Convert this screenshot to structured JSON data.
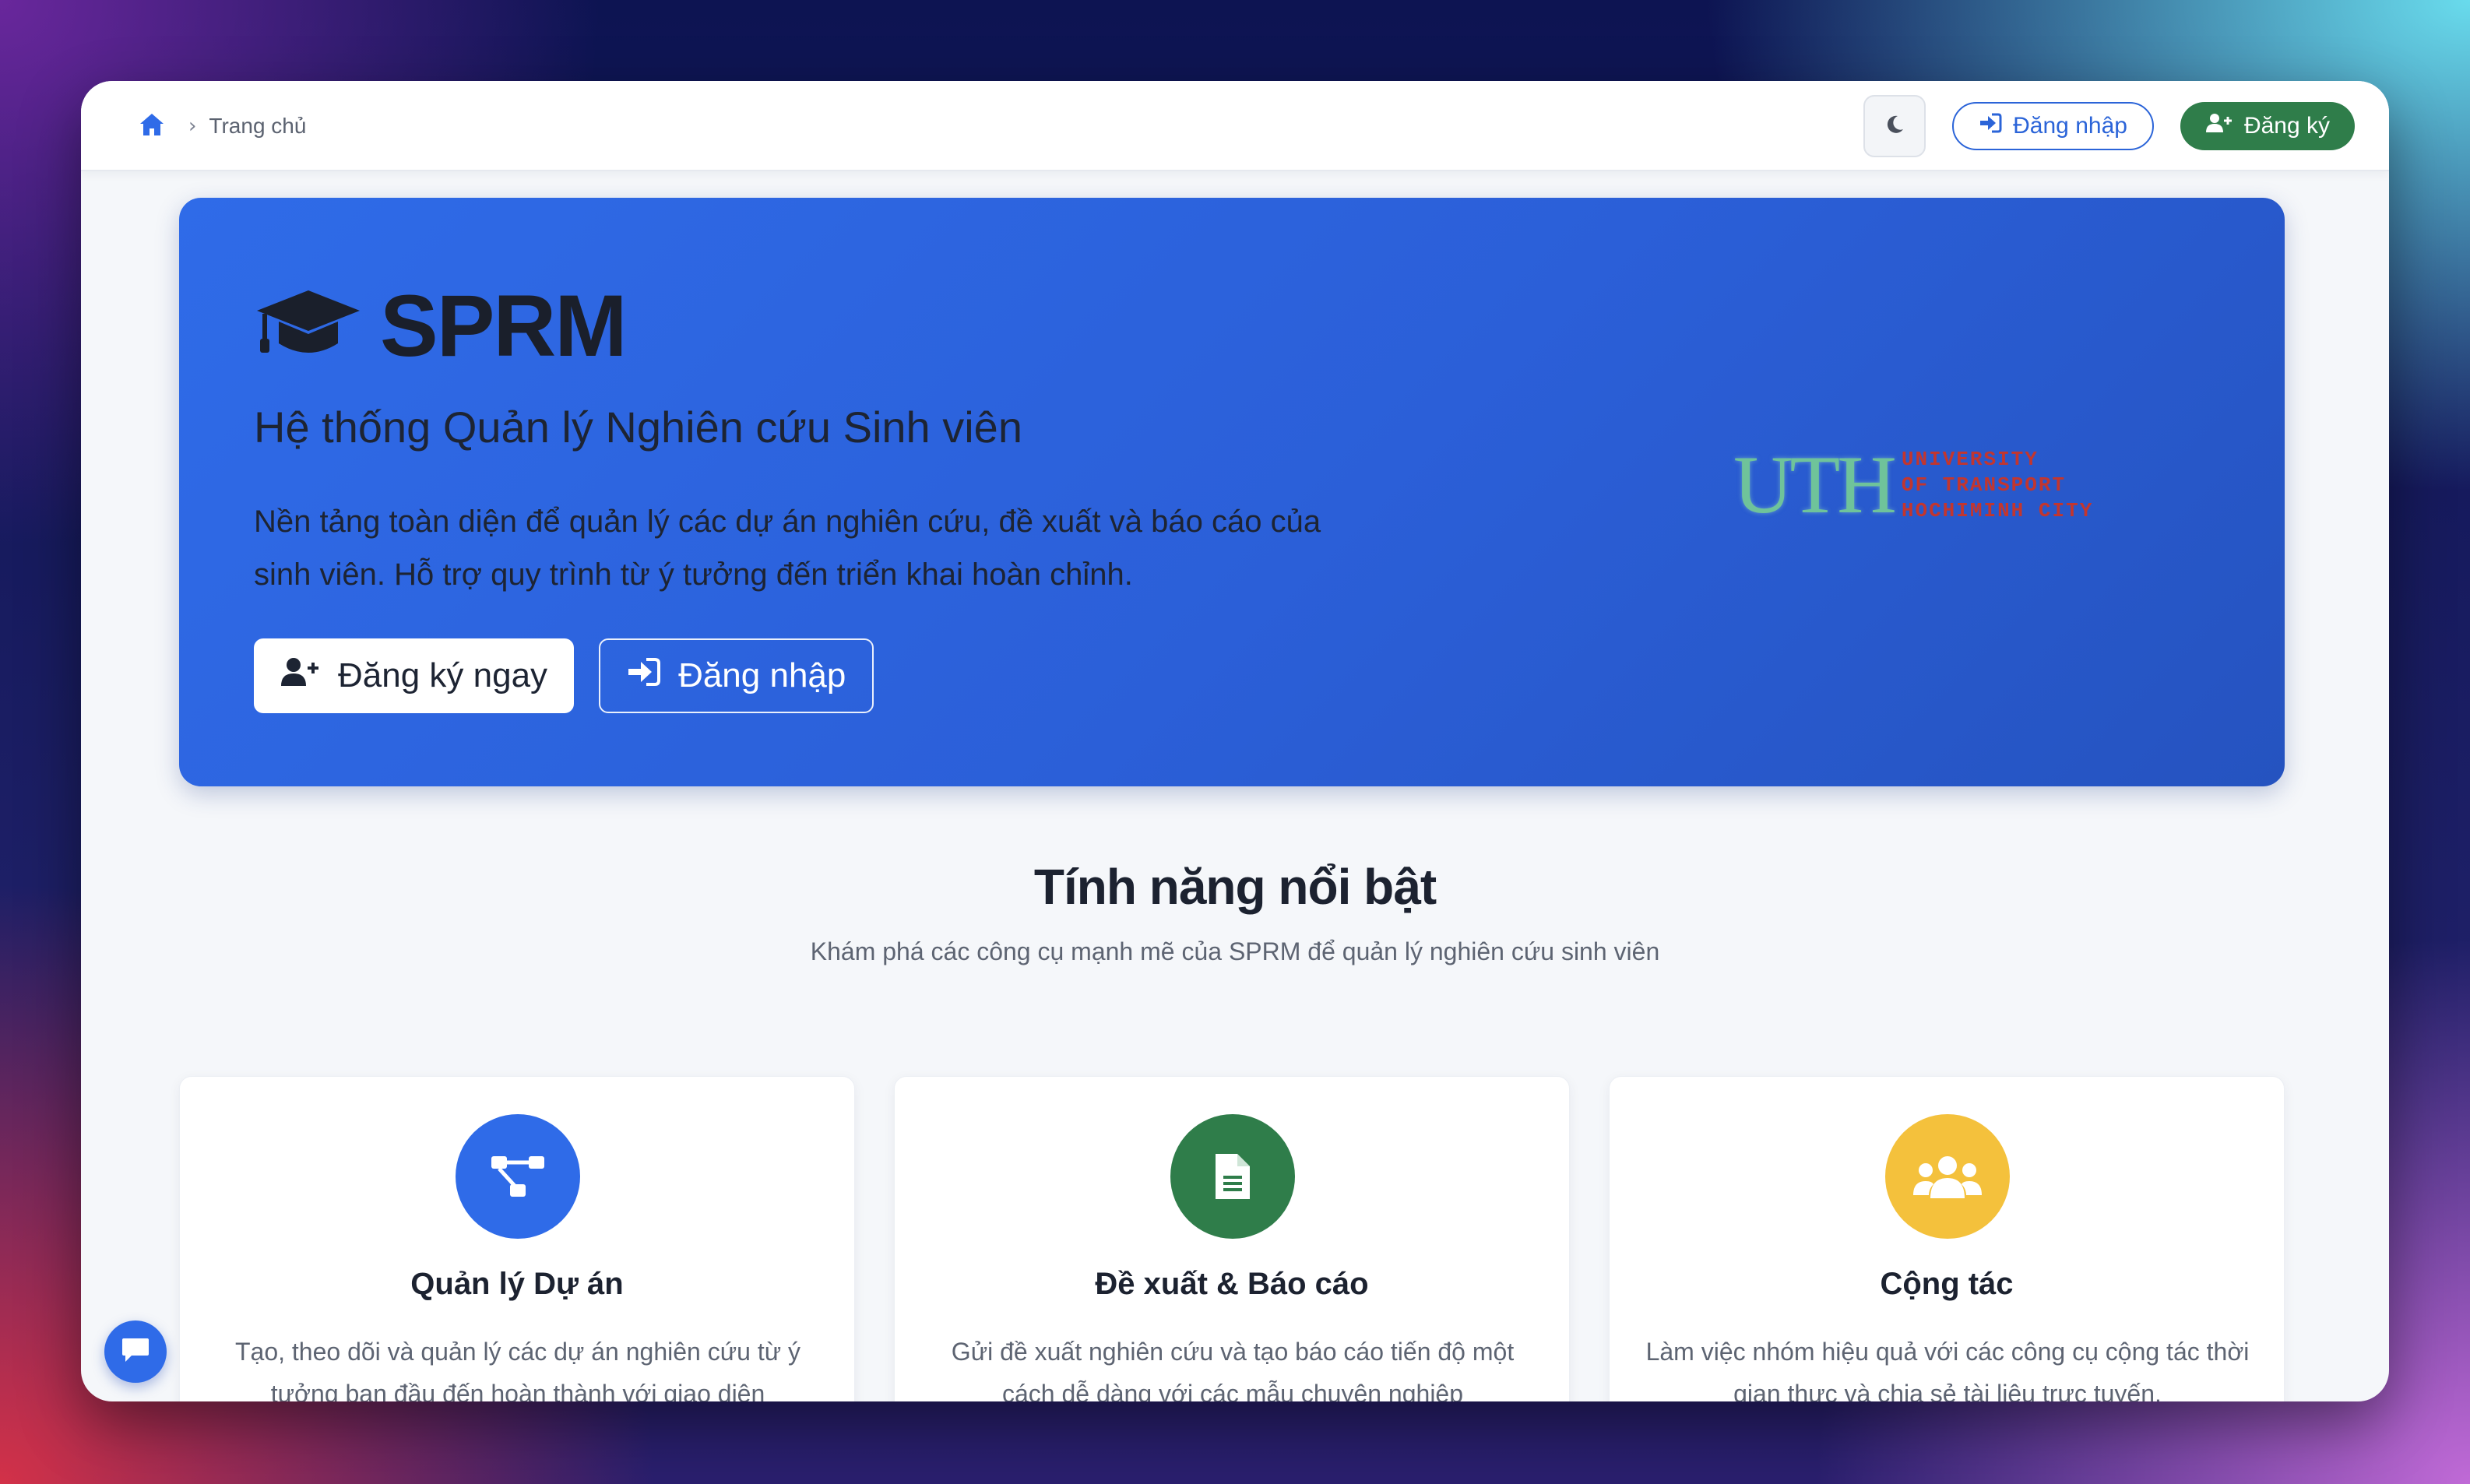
{
  "breadcrumb": {
    "home_icon": "home-icon",
    "current": "Trang chủ"
  },
  "header": {
    "theme_icon": "moon-icon",
    "login_label": "Đăng nhập",
    "register_label": "Đăng ký"
  },
  "hero": {
    "brand": "SPRM",
    "brand_icon": "graduation-cap-icon",
    "subtitle": "Hệ thống Quản lý Nghiên cứu Sinh viên",
    "description": "Nền tảng toàn diện để quản lý các dự án nghiên cứu, đề xuất và báo cáo của sinh viên. Hỗ trợ quy trình từ ý tưởng đến triển khai hoàn chỉnh.",
    "register_now_label": "Đăng ký ngay",
    "login_label": "Đăng nhập",
    "logo": {
      "mark": "UTH",
      "line1": "UNIVERSITY",
      "line2": "OF TRANSPORT",
      "line3": "HOCHIMINH CITY"
    }
  },
  "features": {
    "title": "Tính năng nổi bật",
    "subtitle": "Khám phá các công cụ mạnh mẽ của SPRM để quản lý nghiên cứu sinh viên",
    "cards": [
      {
        "title": "Quản lý Dự án",
        "text": "Tạo, theo dõi và quản lý các dự án nghiên cứu từ ý tưởng ban đầu đến hoàn thành với giao diện",
        "icon": "project-diagram-icon",
        "color": "#2f6be8"
      },
      {
        "title": "Đề xuất & Báo cáo",
        "text": "Gửi đề xuất nghiên cứu và tạo báo cáo tiến độ một cách dễ dàng với các mẫu chuyên nghiệp",
        "icon": "document-icon",
        "color": "#2f7d4a"
      },
      {
        "title": "Cộng tác",
        "text": "Làm việc nhóm hiệu quả với các công cụ cộng tác thời gian thực và chia sẻ tài liệu trực tuyến.",
        "icon": "users-icon",
        "color": "#f4c13c"
      }
    ]
  },
  "chat": {
    "icon": "chat-icon"
  }
}
